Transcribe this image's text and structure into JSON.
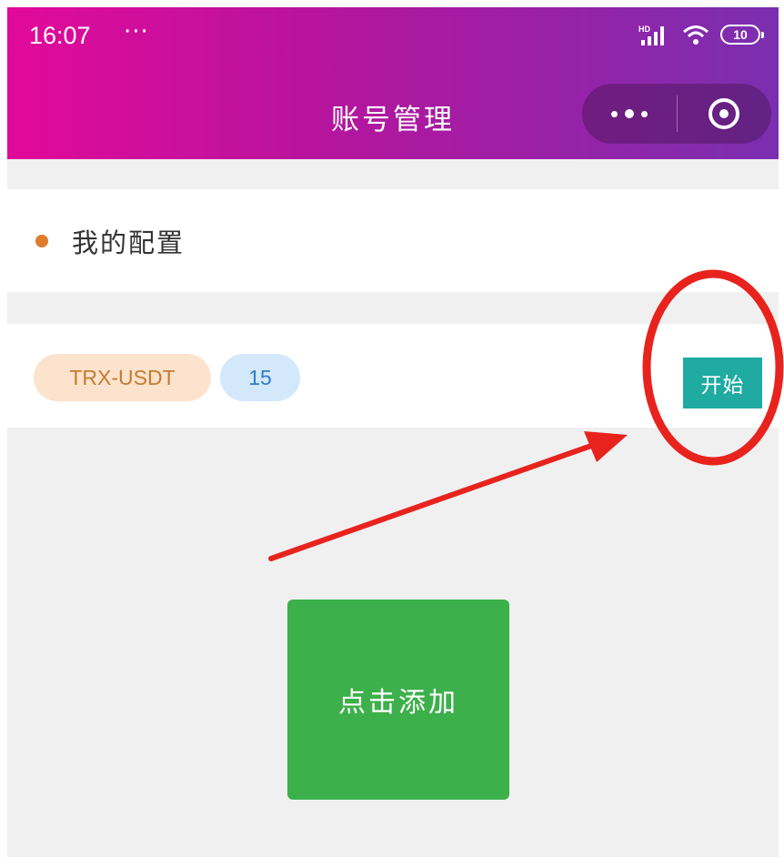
{
  "status_bar": {
    "time": "16:07",
    "dots": "···",
    "network_label": "HD",
    "battery": "10"
  },
  "nav": {
    "title": "账号管理",
    "more_icon": "more-dots-icon",
    "close_icon": "target-circle-icon"
  },
  "section": {
    "title": "我的配置",
    "dot_color": "#e07b2c"
  },
  "config": {
    "pair": "TRX-USDT",
    "value": "15",
    "start_label": "开始"
  },
  "add_button": {
    "label": "点击添加"
  },
  "colors": {
    "header_gradient_start": "#e2099a",
    "header_gradient_end": "#7a2fb0",
    "start_button": "#1faaa2",
    "add_button": "#3cb04a",
    "annotation_red": "#e8231d"
  }
}
